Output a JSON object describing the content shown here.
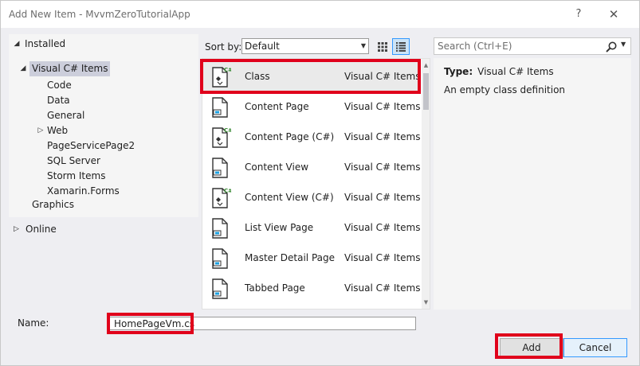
{
  "window": {
    "title": "Add New Item - MvvmZeroTutorialApp",
    "help_glyph": "?",
    "close_glyph": "✕"
  },
  "tree": {
    "installed_label": "Installed",
    "visual_csharp_label": "Visual C# Items",
    "children": [
      {
        "label": "Code"
      },
      {
        "label": "Data"
      },
      {
        "label": "General"
      },
      {
        "label": "Web"
      },
      {
        "label": "PageServicePage2"
      },
      {
        "label": "SQL Server"
      },
      {
        "label": "Storm Items"
      },
      {
        "label": "Xamarin.Forms"
      }
    ],
    "graphics_label": "Graphics",
    "online_label": "Online"
  },
  "sort": {
    "label": "Sort by:",
    "value": "Default"
  },
  "search": {
    "placeholder": "Search (Ctrl+E)"
  },
  "items": [
    {
      "name": "Class",
      "category": "Visual C# Items",
      "icon": "csharp-class-icon"
    },
    {
      "name": "Content Page",
      "category": "Visual C# Items",
      "icon": "xaml-page-icon"
    },
    {
      "name": "Content Page (C#)",
      "category": "Visual C# Items",
      "icon": "csharp-page-icon"
    },
    {
      "name": "Content View",
      "category": "Visual C# Items",
      "icon": "xaml-page-icon"
    },
    {
      "name": "Content View (C#)",
      "category": "Visual C# Items",
      "icon": "csharp-page-icon"
    },
    {
      "name": "List View Page",
      "category": "Visual C# Items",
      "icon": "xaml-page-icon"
    },
    {
      "name": "Master Detail Page",
      "category": "Visual C# Items",
      "icon": "xaml-page-icon"
    },
    {
      "name": "Tabbed Page",
      "category": "Visual C# Items",
      "icon": "xaml-page-icon"
    }
  ],
  "details": {
    "type_label": "Type:",
    "type_value": "Visual C# Items",
    "description": "An empty class definition"
  },
  "name_field": {
    "label": "Name:",
    "value": "HomePageVm.cs"
  },
  "buttons": {
    "add": "Add",
    "cancel": "Cancel"
  },
  "colors": {
    "highlight": "#e0001b",
    "csharp_green": "#388a34",
    "xaml_blue": "#1ba1e2"
  }
}
